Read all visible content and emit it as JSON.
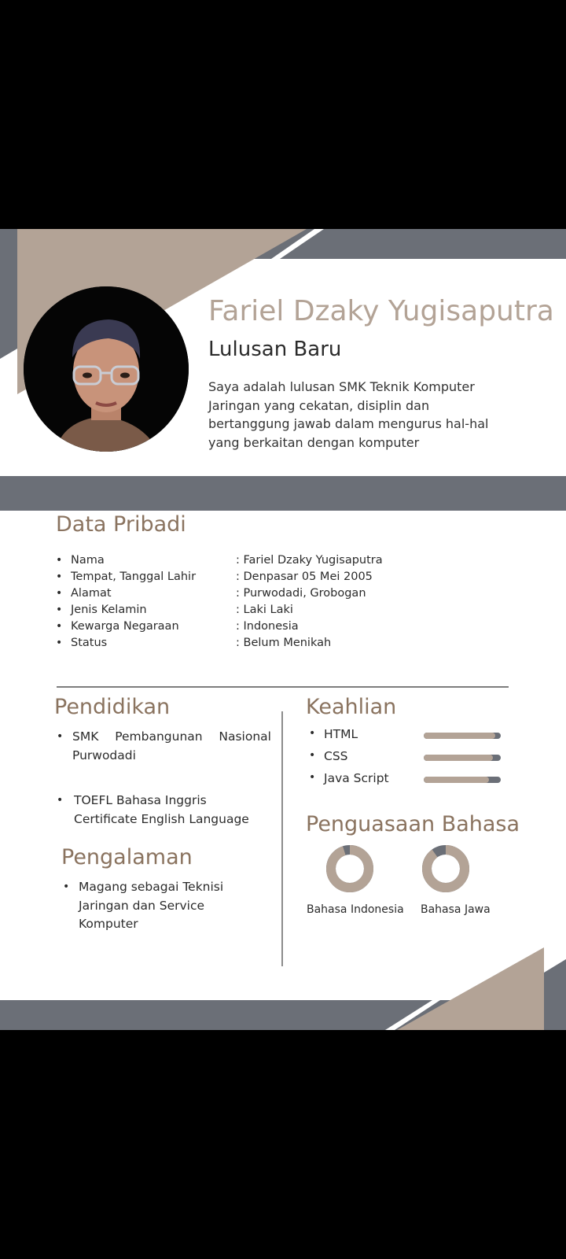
{
  "header": {
    "name": "Fariel Dzaky Yugisaputra",
    "subtitle": "Lulusan Baru",
    "summary": "Saya adalah lulusan SMK Teknik Komputer Jaringan yang cekatan, disiplin dan bertanggung jawab dalam mengurus hal-hal yang berkaitan dengan komputer"
  },
  "personal": {
    "title": "Data Pribadi",
    "items": [
      {
        "label": "Nama",
        "value": ": Fariel Dzaky Yugisaputra"
      },
      {
        "label": "Tempat, Tanggal Lahir",
        "value": ": Denpasar 05 Mei 2005"
      },
      {
        "label": "Alamat",
        "value": ": Purwodadi, Grobogan"
      },
      {
        "label": "Jenis Kelamin",
        "value": ": Laki Laki"
      },
      {
        "label": "Kewarga Negaraan",
        "value": ": Indonesia"
      },
      {
        "label": "Status",
        "value": ": Belum Menikah"
      }
    ]
  },
  "education": {
    "title": "Pendidikan",
    "items": [
      {
        "line1_words": [
          "SMK",
          "Pembangunan",
          "Nasional"
        ],
        "line2": "Purwodadi"
      },
      {
        "line1": "TOEFL Bahasa Inggris",
        "line2": "Certificate English Language"
      }
    ]
  },
  "experience": {
    "title": "Pengalaman",
    "items": [
      {
        "lines": [
          "Magang sebagai Teknisi",
          "Jaringan dan Service",
          "Komputer"
        ]
      }
    ]
  },
  "skills": {
    "title": "Keahlian",
    "items": [
      {
        "label": "HTML",
        "level": 0.93
      },
      {
        "label": "CSS",
        "level": 0.9
      },
      {
        "label": "Java Script",
        "level": 0.85
      }
    ]
  },
  "languages": {
    "title": "Penguasaan Bahasa",
    "items": [
      {
        "label": "Bahasa Indonesia",
        "level": 0.95
      },
      {
        "label": "Bahasa Jawa",
        "level": 0.9
      }
    ]
  },
  "bullet": "•",
  "colors": {
    "tan": "#b3a396",
    "slate": "#6b6f77",
    "heading": "#8a735f"
  }
}
